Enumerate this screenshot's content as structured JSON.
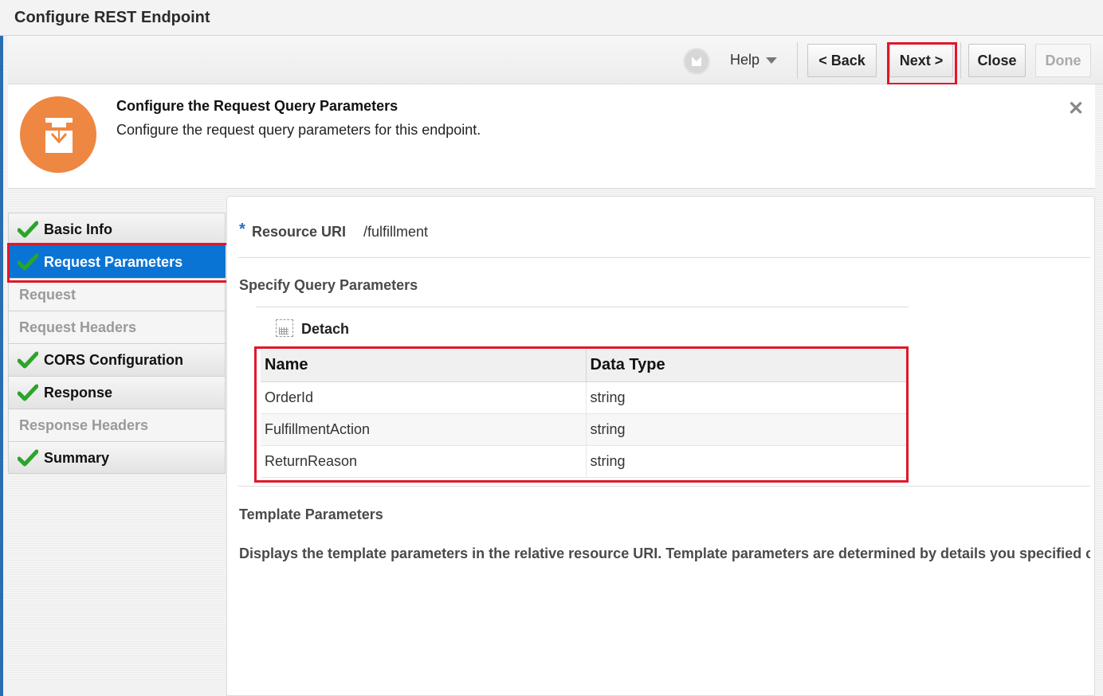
{
  "window": {
    "title": "Configure REST Endpoint"
  },
  "toolbar": {
    "help_label": "Help",
    "back_label": "<  Back",
    "next_label": "Next  >",
    "close_label": "Close",
    "done_label": "Done"
  },
  "header": {
    "title": "Configure the Request Query Parameters",
    "subtitle": "Configure the request query parameters for this endpoint.",
    "close_glyph": "✕"
  },
  "nav": {
    "items": [
      {
        "label": "Basic Info",
        "completed": true,
        "active": false
      },
      {
        "label": "Request Parameters",
        "completed": true,
        "active": true
      },
      {
        "label": "Request",
        "completed": false,
        "active": false
      },
      {
        "label": "Request Headers",
        "completed": false,
        "active": false
      },
      {
        "label": "CORS Configuration",
        "completed": true,
        "active": false
      },
      {
        "label": "Response",
        "completed": true,
        "active": false
      },
      {
        "label": "Response Headers",
        "completed": false,
        "active": false
      },
      {
        "label": "Summary",
        "completed": true,
        "active": false
      }
    ]
  },
  "main": {
    "required_marker": "*",
    "resource_uri_label": "Resource URI",
    "resource_uri_value": "/fulfillment",
    "query_section_title": "Specify Query Parameters",
    "detach_label": "Detach",
    "table": {
      "columns": [
        "Name",
        "Data Type"
      ],
      "rows": [
        [
          "OrderId",
          "string"
        ],
        [
          "FulfillmentAction",
          "string"
        ],
        [
          "ReturnReason",
          "string"
        ]
      ]
    },
    "template_section_title": "Template Parameters",
    "template_description": "Displays the template parameters in the relative resource URI. Template parameters are determined by details you specified c"
  },
  "colors": {
    "accent": "#0a74d4",
    "highlight": "#e0172b",
    "check": "#2aa52a",
    "header_icon": "#ee8741"
  }
}
